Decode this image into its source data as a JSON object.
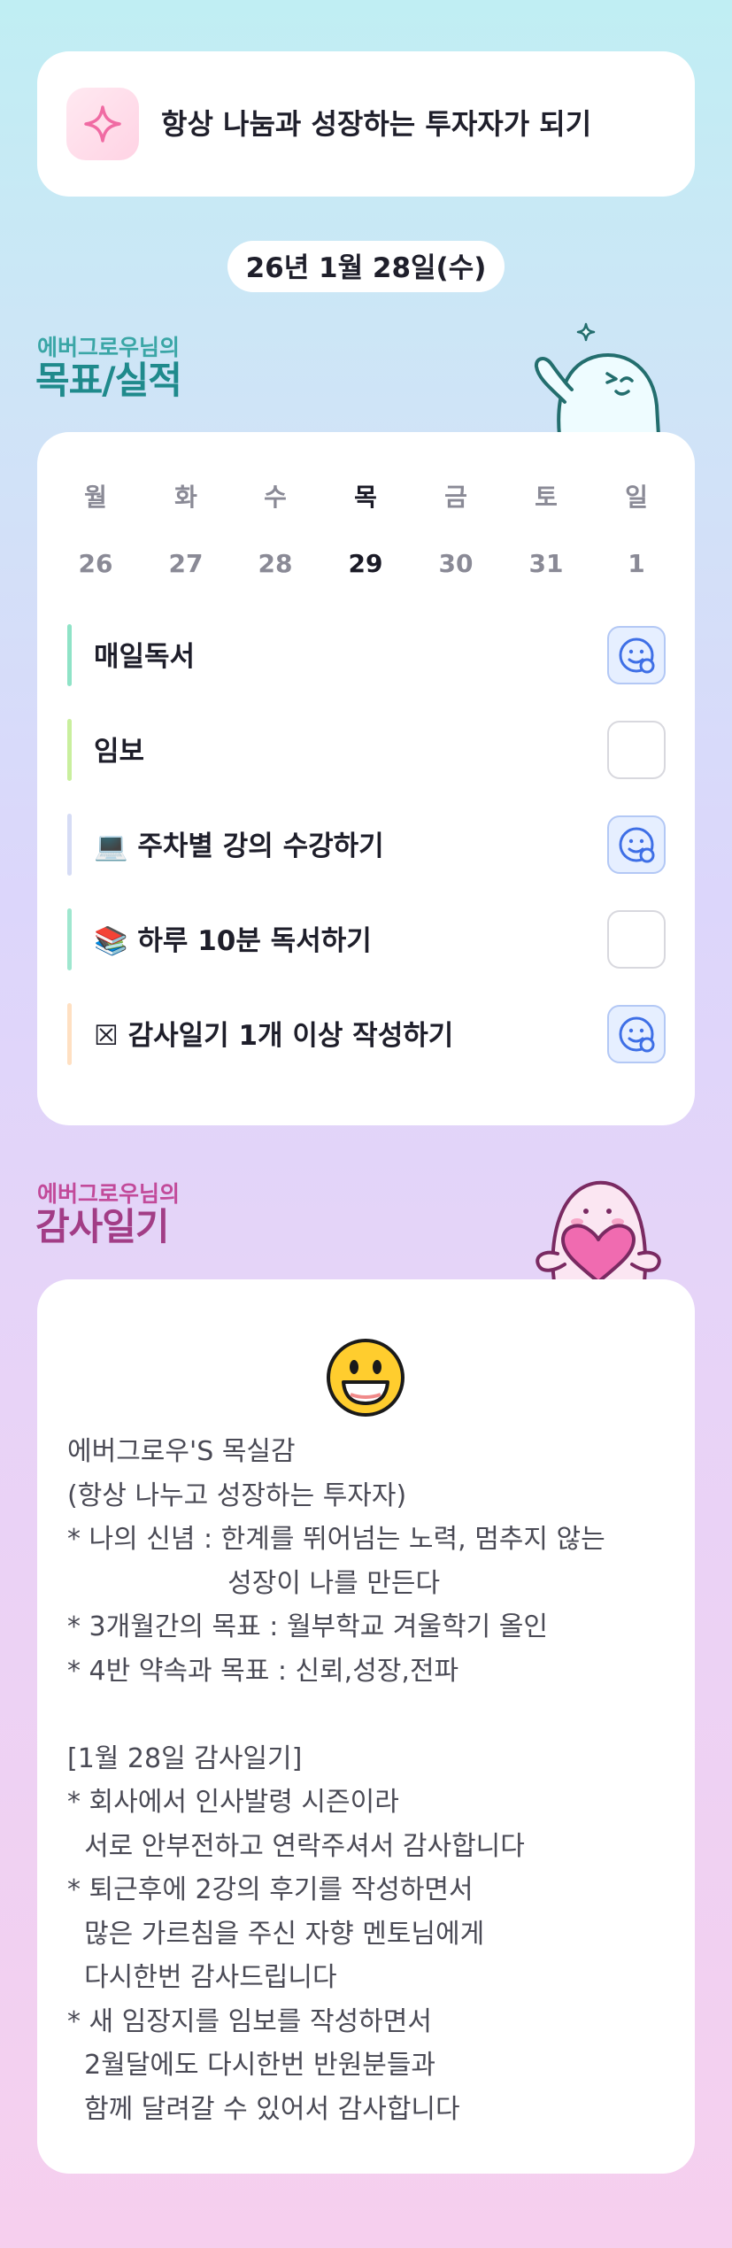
{
  "motto": {
    "text": "항상 나눔과 성장하는 투자자가 되기",
    "icon": "sparkle-icon"
  },
  "date": "26년 1월 28일(수)",
  "goals_section": {
    "subtitle": "에버그로우님의",
    "title": "목표/실적",
    "mascot": "waving-ghost-mascot"
  },
  "week": [
    {
      "day": "월",
      "date": "26"
    },
    {
      "day": "화",
      "date": "27"
    },
    {
      "day": "수",
      "date": "28"
    },
    {
      "day": "목",
      "date": "29",
      "today": true
    },
    {
      "day": "금",
      "date": "30"
    },
    {
      "day": "토",
      "date": "31"
    },
    {
      "day": "일",
      "date": "1"
    }
  ],
  "goals": [
    {
      "label": "매일독서",
      "done": true,
      "bar_color": "#8fe3c7"
    },
    {
      "label": "임보",
      "done": false,
      "bar_color": "#c9ef9e"
    },
    {
      "label": "💻 주차별 강의 수강하기",
      "done": true,
      "bar_color": "#d6dcf5"
    },
    {
      "label": "📚 하루 10분 독서하기",
      "done": false,
      "bar_color": "#9fe7cf"
    },
    {
      "label": "☒ 감사일기 1개 이상 작성하기",
      "done": true,
      "bar_color": "#ffe0c2"
    }
  ],
  "gratitude_section": {
    "subtitle": "에버그로우님의",
    "title": "감사일기",
    "mascot": "heart-ghost-mascot"
  },
  "gratitude": {
    "emoji": "grinning-face-icon",
    "text": "에버그로우'S 목실감\n(항상 나누고 성장하는 투자자)\n* 나의 신념 : 한계를 뛰어넘는 노력, 멈추지 않는\n                   성장이 나를 만든다\n* 3개월간의 목표 : 월부학교 겨울학기 올인\n* 4반 약속과 목표 : 신뢰,성장,전파\n\n[1월 28일 감사일기]\n* 회사에서 인사발령 시즌이라\n  서로 안부전하고 연락주셔서 감사합니다\n* 퇴근후에 2강의 후기를 작성하면서\n  많은 가르침을 주신 자향 멘토님에게\n  다시한번 감사드립니다\n* 새 임장지를 임보를 작성하면서\n  2월달에도 다시한번 반원분들과\n  함께 달려갈 수 있어서 감사합니다"
  },
  "colors": {
    "goal_title": "#1f8a8c",
    "gratitude_title": "#a23d86",
    "check_done": "#e6efff"
  }
}
